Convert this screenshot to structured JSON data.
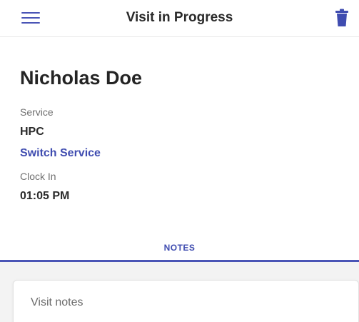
{
  "header": {
    "title": "Visit in Progress",
    "menu_icon": "hamburger-menu-icon",
    "delete_icon": "trash-icon",
    "accent_color": "#4a55b6"
  },
  "visit": {
    "patient_name": "Nicholas Doe",
    "service_label": "Service",
    "service_value": "HPC",
    "switch_service_label": "Switch Service",
    "clock_in_label": "Clock In",
    "clock_in_value": "01:05 PM"
  },
  "tabs": [
    {
      "label": "NOTES",
      "active": true
    }
  ],
  "notes": {
    "placeholder": "Visit notes",
    "value": ""
  }
}
